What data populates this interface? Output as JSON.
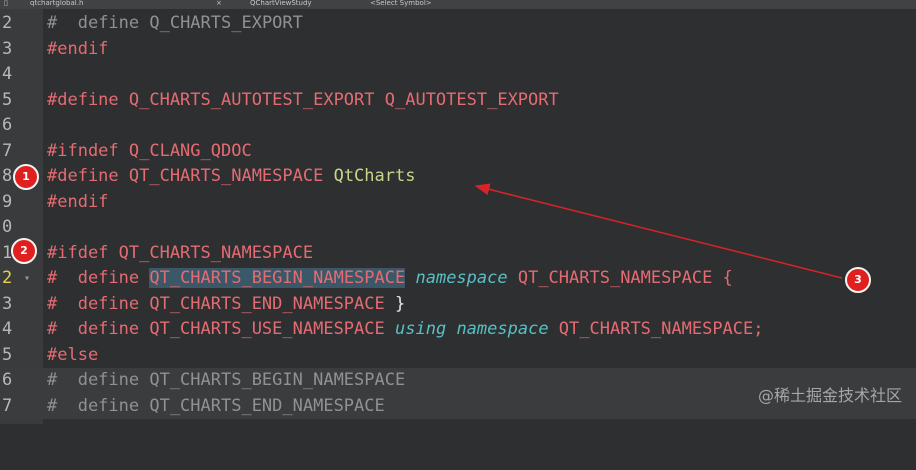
{
  "toolbar": {
    "file": "qtchartglobal.h",
    "close": "×",
    "project": "QChartViewStudy",
    "symbol": "<Select Symbol>"
  },
  "lines": [
    {
      "num": "2",
      "text": "#  define Q_CHARTS_EXPORT"
    },
    {
      "num": "3",
      "text": "#endif"
    },
    {
      "num": "4",
      "text": ""
    },
    {
      "num": "5",
      "text": "#define Q_CHARTS_AUTOTEST_EXPORT Q_AUTOTEST_EXPORT"
    },
    {
      "num": "6",
      "text": ""
    },
    {
      "num": "7",
      "text": "#ifndef Q_CLANG_QDOC"
    },
    {
      "num": "8",
      "text": "#define QT_CHARTS_NAMESPACE QtCharts"
    },
    {
      "num": "9",
      "text": "#endif"
    },
    {
      "num": "0",
      "text": ""
    },
    {
      "num": "1",
      "text": "#ifdef QT_CHARTS_NAMESPACE"
    },
    {
      "num": "2",
      "text": "#  define QT_CHARTS_BEGIN_NAMESPACE namespace QT_CHARTS_NAMESPACE {"
    },
    {
      "num": "3",
      "text": "#  define QT_CHARTS_END_NAMESPACE }"
    },
    {
      "num": "4",
      "text": "#  define QT_CHARTS_USE_NAMESPACE using namespace QT_CHARTS_NAMESPACE;"
    },
    {
      "num": "5",
      "text": "#else"
    },
    {
      "num": "6",
      "text": "#  define QT_CHARTS_BEGIN_NAMESPACE"
    },
    {
      "num": "7",
      "text": "#  define QT_CHARTS_END_NAMESPACE"
    }
  ],
  "tokens": {
    "l2_hash": "#",
    "l2_rest": "  define Q_CHARTS_EXPORT",
    "l3": "#endif",
    "l5": "#define Q_CHARTS_AUTOTEST_EXPORT Q_AUTOTEST_EXPORT",
    "l7": "#ifndef Q_CLANG_QDOC",
    "l8_pp": "#define QT_CHARTS_NAMESPACE ",
    "l8_ns": "QtCharts",
    "l9": "#endif",
    "l11": "#ifdef QT_CHARTS_NAMESPACE",
    "l12_pre": "#  define ",
    "l12_hl": "QT_CHARTS_BEGIN_NAMESPACE",
    "l12_kw": "namespace",
    "l12_post": " QT_CHARTS_NAMESPACE {",
    "l13_pre": "#  define QT_CHARTS_END_NAMESPACE ",
    "l13_brace": "}",
    "l14_pre": "#  define QT_CHARTS_USE_NAMESPACE ",
    "l14_kw1": "using",
    "l14_kw2": "namespace",
    "l14_post": " QT_CHARTS_NAMESPACE;",
    "l15": "#else",
    "l16": "#  define QT_CHARTS_BEGIN_NAMESPACE",
    "l17": "#  define QT_CHARTS_END_NAMESPACE",
    "fold_marker": "▾"
  },
  "badges": [
    "1",
    "2",
    "3"
  ],
  "watermark": "@稀土掘金技术社区",
  "colors": {
    "preprocessor": "#e56b73",
    "namespace_value": "#c9d48a",
    "keyword": "#56c0c6",
    "badge": "#e0201e",
    "arrow": "#d8232a"
  }
}
